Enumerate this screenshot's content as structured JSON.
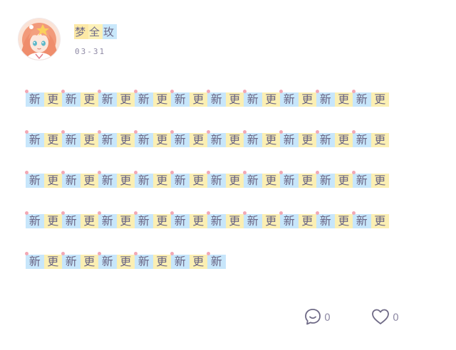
{
  "post": {
    "author": {
      "name_chars": [
        "梦",
        "全",
        "玫"
      ],
      "avatar_icon": "anime-avatar"
    },
    "date": "03-31",
    "body_lines": [
      "新更新更新更新更新更新更新更新更新更新更",
      "新更新更新更新更新更新更新更新更新更新更",
      "新更新更新更新更新更新更新更新更新更新更",
      "新更新更新更新更新更新更新更新更新更新更",
      "新更新更新更新更新更新"
    ],
    "highlight_colors": {
      "blue": "#c7e6fb",
      "yellow": "#fbefb3",
      "dot": "#f2a8b4"
    },
    "actions": {
      "comment": {
        "icon": "comment-bubble-icon",
        "count": "0"
      },
      "like": {
        "icon": "heart-icon",
        "count": "0"
      }
    }
  }
}
